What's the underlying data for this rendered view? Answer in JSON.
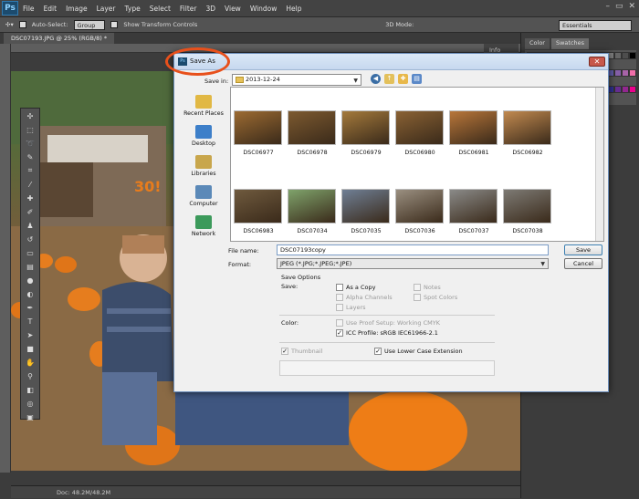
{
  "app": {
    "logo": "Ps",
    "menus": [
      "File",
      "Edit",
      "Image",
      "Layer",
      "Type",
      "Select",
      "Filter",
      "3D",
      "View",
      "Window",
      "Help"
    ],
    "window_controls": [
      "–",
      "▭",
      "✕"
    ]
  },
  "options_bar": {
    "auto_select_label": "Auto-Select:",
    "auto_select_value": "Group",
    "show_transform_label": "Show Transform Controls",
    "mode_label": "3D Mode:",
    "workspace": "Essentials"
  },
  "document": {
    "tab_label": "DSC07193.JPG @ 25% (RGB/8) *",
    "status": "Doc: 48.2M/48.2M"
  },
  "right_panel": {
    "tabs": [
      "Color",
      "Swatches"
    ],
    "info_tab": "Info",
    "swatch_colors": [
      "#ff0000",
      "#ffff00",
      "#00ff00",
      "#00ffff",
      "#0000ff",
      "#ff00ff",
      "#ffffff",
      "#e6e6e6",
      "#cccccc",
      "#b3b3b3",
      "#999999",
      "#808080",
      "#666666",
      "#4d4d4d",
      "#000000",
      "#f26c4f",
      "#f68e55",
      "#fbaf5c",
      "#fff467",
      "#acd372",
      "#7cc576",
      "#3bb878",
      "#1abbb4",
      "#00bff3",
      "#438cca",
      "#5574b9",
      "#605ca8",
      "#855fa8",
      "#a763a8",
      "#f06ea9",
      "#ed1c24",
      "#f26522",
      "#f7941d",
      "#fff200",
      "#8dc63f",
      "#39b54a",
      "#00a651",
      "#00a99d",
      "#00aeef",
      "#0072bc",
      "#0054a6",
      "#2e3192",
      "#662d91",
      "#92278f",
      "#ec008c"
    ]
  },
  "dialog": {
    "title": "Save As",
    "save_in_label": "Save in:",
    "save_in_value": "2013-12-24",
    "places": [
      {
        "label": "Recent Places",
        "color": "#e1b844"
      },
      {
        "label": "Desktop",
        "color": "#3d7fc9"
      },
      {
        "label": "Libraries",
        "color": "#c8a64c"
      },
      {
        "label": "Computer",
        "color": "#5b89b8"
      },
      {
        "label": "Network",
        "color": "#3c9a5b"
      }
    ],
    "files": [
      {
        "name": "DSC06977",
        "color": "#9c6b32"
      },
      {
        "name": "DSC06978",
        "color": "#7d5a30"
      },
      {
        "name": "DSC06979",
        "color": "#a47a3c"
      },
      {
        "name": "DSC06980",
        "color": "#8a6234"
      },
      {
        "name": "DSC06981",
        "color": "#b8763a"
      },
      {
        "name": "DSC06982",
        "color": "#c28a50"
      },
      {
        "name": "DSC06983",
        "color": "#6f5a3e"
      },
      {
        "name": "DSC07034",
        "color": "#7fa36b"
      },
      {
        "name": "DSC07035",
        "color": "#6f7f95"
      },
      {
        "name": "DSC07036",
        "color": "#9a8f80"
      },
      {
        "name": "DSC07037",
        "color": "#8a8a88"
      },
      {
        "name": "DSC07038",
        "color": "#7d7a74"
      }
    ],
    "file_name_label": "File name:",
    "file_name_value": "DSC07193copy",
    "format_label": "Format:",
    "format_value": "JPEG (*.JPG;*.JPEG;*.JPE)",
    "save_button": "Save",
    "cancel_button": "Cancel",
    "save_options_title": "Save Options",
    "save_label": "Save:",
    "options": {
      "as_a_copy": "As a Copy",
      "notes": "Notes",
      "alpha_channels": "Alpha Channels",
      "spot_colors": "Spot Colors",
      "layers": "Layers"
    },
    "color_label": "Color:",
    "use_proof_setup": "Use Proof Setup:  Working CMYK",
    "icc_profile": "ICC Profile:  sRGB IEC61966-2.1",
    "thumbnail": "Thumbnail",
    "lower_case_ext": "Use Lower Case Extension",
    "check_mark": "✓"
  }
}
